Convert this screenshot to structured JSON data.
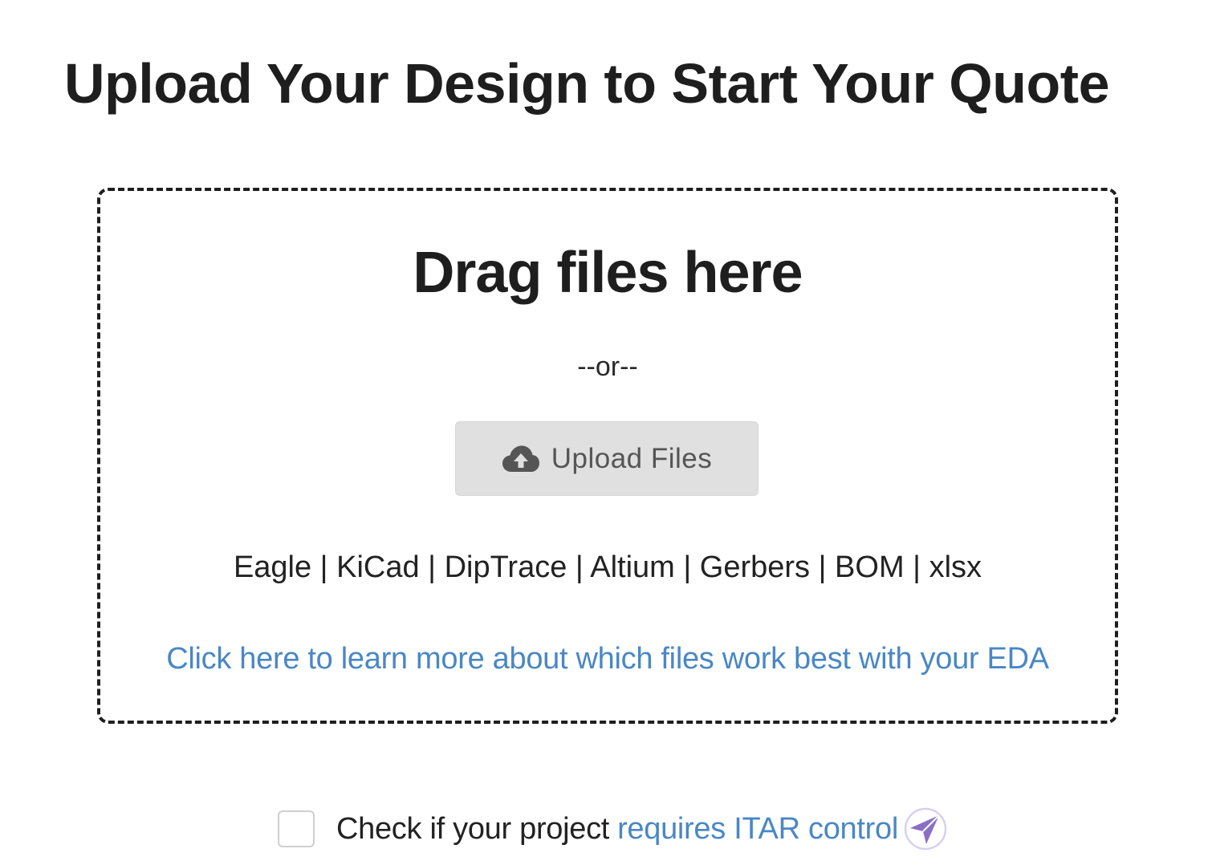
{
  "header": {
    "title": "Upload Your Design to Start Your Quote"
  },
  "dropzone": {
    "drag_text": "Drag files here",
    "or_text": "--or--",
    "upload_button": {
      "icon": "cloud-upload-icon",
      "label": "Upload Files"
    },
    "formats": "Eagle | KiCad | DipTrace | Altium | Gerbers | BOM | xlsx",
    "learn_more_link": "Click here to learn more about which files work best with your EDA"
  },
  "itar": {
    "checked": false,
    "text": "Check if your project",
    "link": "requires ITAR control",
    "icon": "paper-plane-icon"
  },
  "colors": {
    "link": "#4a87c5",
    "button_bg": "#e0e0e0",
    "icon_accent": "#8a6fc7"
  }
}
